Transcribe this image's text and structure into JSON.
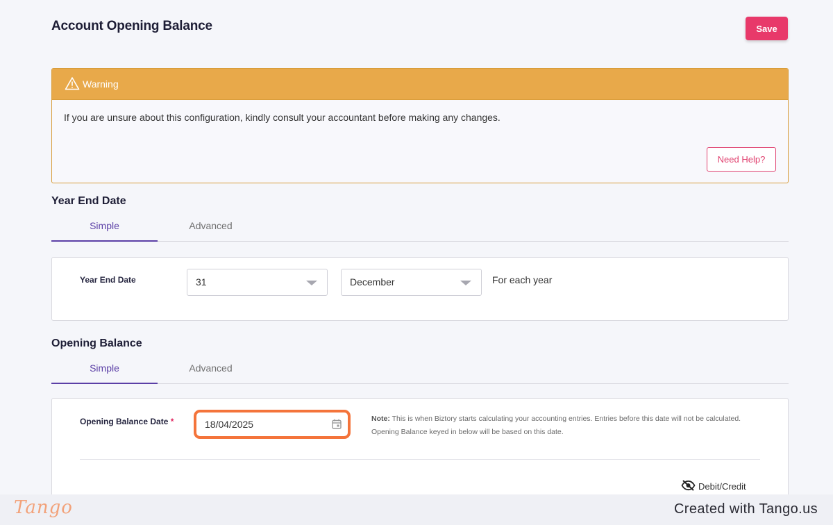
{
  "header": {
    "title": "Account Opening Balance",
    "save_label": "Save"
  },
  "warning": {
    "title": "Warning",
    "message": "If you are unsure about this configuration, kindly consult your accountant before making any changes.",
    "help_label": "Need Help?",
    "icon": "warning-triangle-icon"
  },
  "year_end": {
    "section_title": "Year End Date",
    "tabs": [
      {
        "label": "Simple",
        "active": true
      },
      {
        "label": "Advanced",
        "active": false
      }
    ],
    "field_label": "Year End Date",
    "day_value": "31",
    "month_value": "December",
    "suffix": "For each year"
  },
  "opening_balance": {
    "section_title": "Opening Balance",
    "tabs": [
      {
        "label": "Simple",
        "active": true
      },
      {
        "label": "Advanced",
        "active": false
      }
    ],
    "field_label": "Opening Balance Date",
    "required_mark": "*",
    "date_value": "18/04/2025",
    "note_label": "Note:",
    "note_text": "This is when Biztory starts calculating your accounting entries. Entries before this date will not be calculated. Opening Balance keyed in below will be based on this date.",
    "toggle_label": "Debit/Credit",
    "toggle_icon": "eye-off-icon"
  },
  "colors": {
    "accent": "#e8396a",
    "warning": "#e8a94a",
    "tab_active": "#5b3fa6",
    "highlight": "#f4743b"
  },
  "footer": {
    "logo_text": "Tango",
    "credit": "Created with Tango.us"
  }
}
